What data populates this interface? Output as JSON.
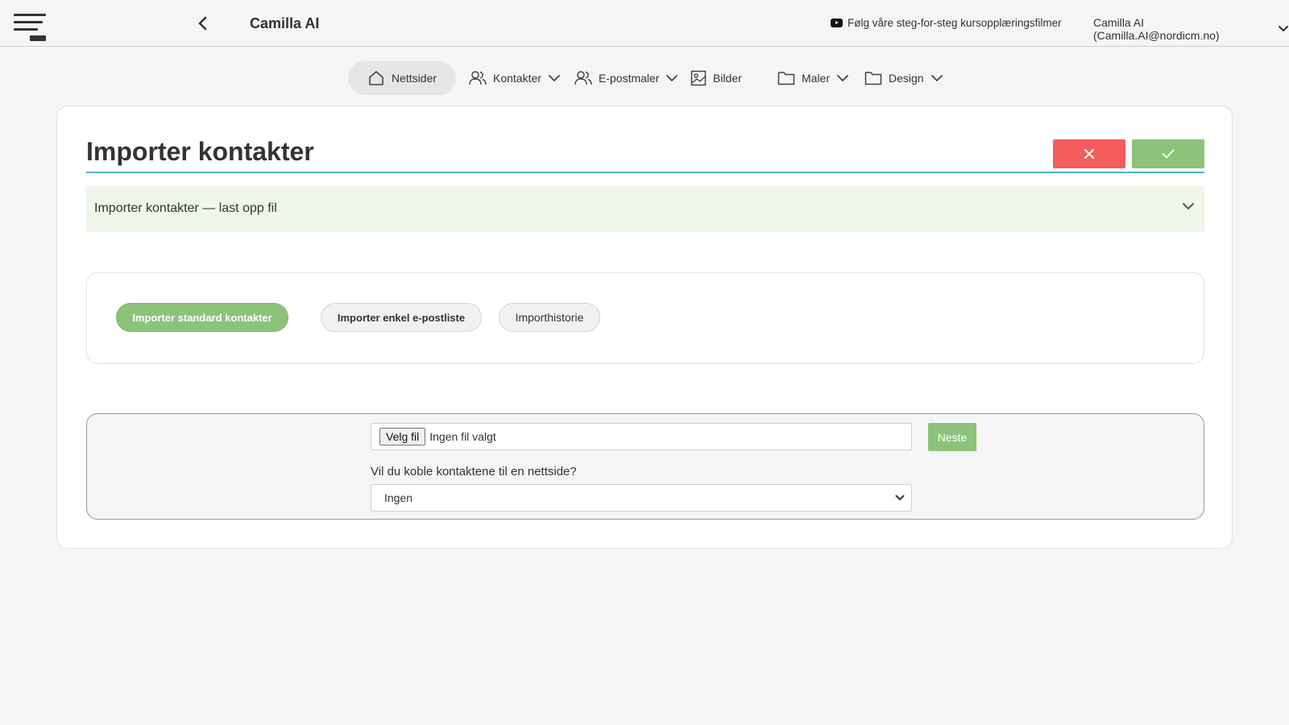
{
  "header": {
    "app_title": "Camilla AI",
    "tutorial_link": "Følg våre steg-for-steg kursopplæringsfilmer",
    "user_label": "Camilla AI (Camilla.AI@nordicm.no)"
  },
  "nav": {
    "items": [
      {
        "label": "Nettsider",
        "icon": "home-icon",
        "active": true
      },
      {
        "label": "Kontakter",
        "icon": "users-icon",
        "dropdown": true
      },
      {
        "label": "E-postmaler",
        "icon": "users-icon",
        "dropdown": true
      },
      {
        "label": "Bilder",
        "icon": "image-icon"
      },
      {
        "label": "Maler",
        "icon": "folder-icon",
        "dropdown": true
      },
      {
        "label": "Design",
        "icon": "folder-icon",
        "dropdown": true
      }
    ]
  },
  "main": {
    "title": "Importer kontakter",
    "accordion_label": "Importer kontakter — last opp fil",
    "tabs": [
      {
        "label": "Importer standard kontakter",
        "active": true
      },
      {
        "label": "Importer enkel e-postliste"
      },
      {
        "label": "Importhistorie"
      }
    ],
    "upload": {
      "file_button": "Velg fil",
      "file_status": "Ingen fil valgt",
      "next_label": "Neste",
      "link_question": "Vil du koble kontaktene til en nettside?",
      "select_value": "Ingen"
    }
  },
  "colors": {
    "accent_green": "#8cc37a",
    "cancel_red": "#f35d5d",
    "title_rule": "#4eb3d3",
    "accordion_bg": "#eef7e9"
  }
}
